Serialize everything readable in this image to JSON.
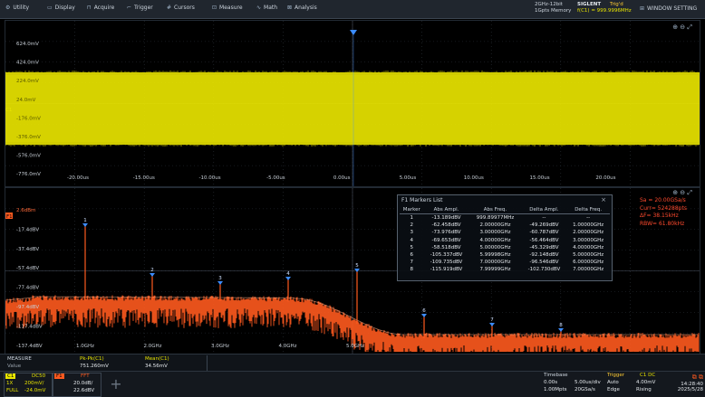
{
  "menu": [
    {
      "icon": "utility-icon",
      "glyph": "⚙",
      "label": "Utility"
    },
    {
      "icon": "display-icon",
      "glyph": "▭",
      "label": "Display"
    },
    {
      "icon": "acquire-icon",
      "glyph": "⊓",
      "label": "Acquire"
    },
    {
      "icon": "trigger-icon",
      "glyph": "⌐",
      "label": "Trigger"
    },
    {
      "icon": "cursors-icon",
      "glyph": "#",
      "label": "Cursors"
    },
    {
      "icon": "measure-icon",
      "glyph": "⊡",
      "label": "Measure"
    },
    {
      "icon": "math-icon",
      "glyph": "∿",
      "label": "Math"
    },
    {
      "icon": "analysis-icon",
      "glyph": "⊠",
      "label": "Analysis"
    }
  ],
  "header": {
    "bandwidth": "2GHz-12bit",
    "memory": "1Gpts Memory",
    "brand": "SIGLENT",
    "trig_state": "Trig'd",
    "freq": "f(C1) = 999.9996MHz",
    "window_settings": "WINDOW SETTING"
  },
  "time_pane": {
    "y_labels": [
      "624.0mV",
      "424.0mV",
      "224.0mV",
      "24.0mV",
      "-176.0mV",
      "-376.0mV",
      "-576.0mV",
      "-776.0mV"
    ],
    "x_labels": [
      "-20.00us",
      "-15.00us",
      "-10.00us",
      "-5.00us",
      "0.00us",
      "5.00us",
      "10.00us",
      "15.00us",
      "20.00us"
    ],
    "ch_marker": "C1"
  },
  "freq_pane": {
    "trace_marker": "F1",
    "y_labels": [
      "2.6dBm",
      "-17.4dBV",
      "-37.4dBV",
      "-57.4dBV",
      "-77.4dBV",
      "-97.4dBV",
      "-117.4dBV",
      "-137.4dBV"
    ],
    "x_labels": [
      "1.0GHz",
      "2.0GHz",
      "3.0GHz",
      "4.0GHz",
      "5.0GHz"
    ],
    "marker_numbers": [
      "1",
      "2",
      "3",
      "4",
      "5",
      "6",
      "7",
      "8"
    ],
    "rbw_lines": [
      "Sa = 20.00GSa/s",
      "Curr= 524288pts",
      "ΔF= 38.15kHz",
      "RBW= 61.80kHz"
    ]
  },
  "markers_list": {
    "title": "F1 Markers List",
    "close": "×",
    "headers": [
      "Marker",
      "Abs Ampl.",
      "Abs Freq.",
      "Delta Ampl.",
      "Delta Freq."
    ],
    "rows": [
      [
        "1",
        "-13.189dBV",
        "999.89977MHz",
        "--",
        "--"
      ],
      [
        "2",
        "-62.458dBV",
        "2.00000GHz",
        "-49.269dBV",
        "1.00000GHz"
      ],
      [
        "3",
        "-73.976dBV",
        "3.00000GHz",
        "-60.787dBV",
        "2.00000GHz"
      ],
      [
        "4",
        "-69.653dBV",
        "4.00000GHz",
        "-56.464dBV",
        "3.00000GHz"
      ],
      [
        "5",
        "-58.518dBV",
        "5.00000GHz",
        "-45.329dBV",
        "4.00000GHz"
      ],
      [
        "6",
        "-105.337dBV",
        "5.99998GHz",
        "-92.148dBV",
        "5.00000GHz"
      ],
      [
        "7",
        "-109.735dBV",
        "7.00000GHz",
        "-96.546dBV",
        "6.00000GHz"
      ],
      [
        "8",
        "-115.919dBV",
        "7.99999GHz",
        "-102.730dBV",
        "7.00000GHz"
      ]
    ]
  },
  "measure": {
    "title": "MEASURE",
    "value_label": "Value",
    "m1_name": "Pk-Pk(C1)",
    "m1_value": "751.260mV",
    "m2_name": "Mean(C1)",
    "m2_value": "34.56mV"
  },
  "bottom": {
    "c1_tag": "C1",
    "c1_coupling": "DC50",
    "c1_scale": "1X",
    "c1_volt": "200mV/",
    "c1_bw": "FULL",
    "c1_offset": "-24.0mV",
    "f1_tag": "F1",
    "f1_type": "FFT",
    "f1_scale": "20.0dB/",
    "f1_ref": "22.6dBV",
    "timebase_label": "Timebase",
    "tb_delay": "0.00s",
    "tb_div": "5.00us/div",
    "tb_sa": "1.00Mpts",
    "tb_rate": "20GSa/s",
    "trigger_label": "Trigger",
    "trig_src": "C1 DC",
    "trig_mode": "Auto",
    "trig_level": "4.00mV",
    "trig_edge": "Edge",
    "trig_slope": "Rising",
    "time": "14:28:40",
    "date": "2025/5/28"
  },
  "colors": {
    "ch1": "#e8e400",
    "fft": "#ff5a1f",
    "marker": "#3b8cff"
  }
}
